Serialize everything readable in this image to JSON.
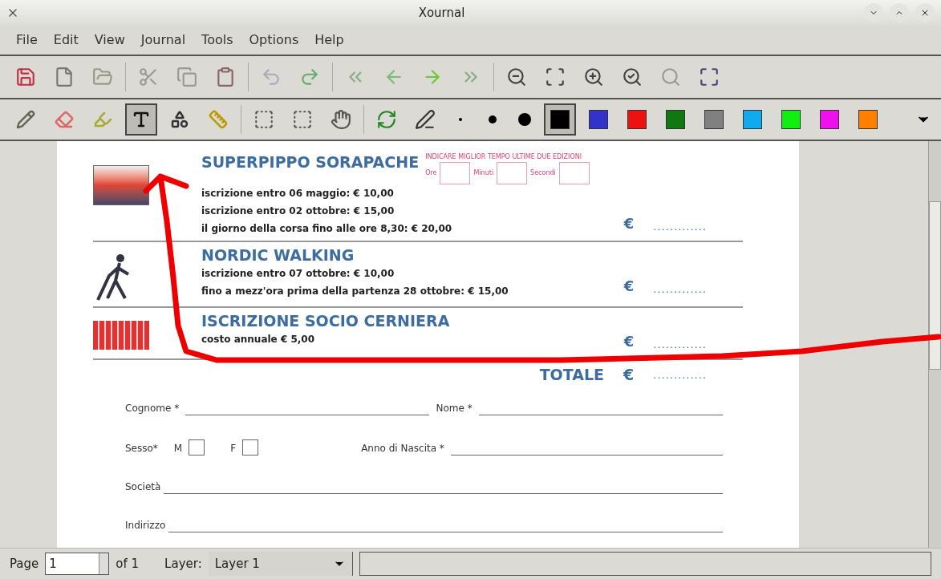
{
  "window": {
    "title": "Xournal"
  },
  "menu": [
    "File",
    "Edit",
    "View",
    "Journal",
    "Tools",
    "Options",
    "Help"
  ],
  "draw_tools": [
    {
      "selected": false
    },
    {
      "selected": false
    },
    {
      "selected": false
    },
    {
      "selected": true
    },
    {
      "selected": false
    },
    {
      "selected": false
    }
  ],
  "colors": [
    {
      "color": "#000000",
      "selected": true
    },
    {
      "color": "#3333cc",
      "selected": false
    },
    {
      "color": "#ee1111",
      "selected": false
    },
    {
      "color": "#117711",
      "selected": false
    },
    {
      "color": "#808080",
      "selected": false
    },
    {
      "color": "#11aaee",
      "selected": false
    },
    {
      "color": "#11ee11",
      "selected": false
    },
    {
      "color": "#ee11ee",
      "selected": false
    },
    {
      "color": "#ff8000",
      "selected": false
    }
  ],
  "document": {
    "time_box": {
      "heading": "INDICARE MIGLIOR TEMPO ULTIME DUE EDIZIONI",
      "fields": [
        "Ore",
        "Minuti",
        "Secondi"
      ]
    },
    "entries": [
      {
        "title": "SUPERPIPPO SORAPACHE",
        "lines": [
          "iscrizione entro 06 maggio: € 10,00",
          "iscrizione entro 02 ottobre: € 15,00",
          "il giorno della corsa fino alle ore 8,30: € 20,00"
        ],
        "currency": "€",
        "amount": "............."
      },
      {
        "title": "NORDIC WALKING",
        "lines": [
          "iscrizione entro 07 ottobre: € 10,00",
          "fino a mezz'ora prima della partenza 28 ottobre: € 15,00"
        ],
        "currency": "€",
        "amount": "............."
      },
      {
        "title": "ISCRIZIONE SOCIO CERNIERA",
        "lines": [
          "costo annuale € 5,00"
        ],
        "currency": "€",
        "amount": "............."
      }
    ],
    "total": {
      "label": "TOTALE",
      "currency": "€",
      "amount": "............."
    },
    "form": {
      "surname": "Cognome *",
      "name": "Nome *",
      "sex": "Sesso*",
      "male": "M",
      "male_checked": false,
      "female": "F",
      "female_checked": false,
      "birth_year": "Anno di Nascita *",
      "club": "Società",
      "address": "Indirizzo"
    }
  },
  "status_bar": {
    "page_label": "Page",
    "page": "1",
    "of": "of 1",
    "layer_label": "Layer:",
    "layer": "Layer 1"
  }
}
